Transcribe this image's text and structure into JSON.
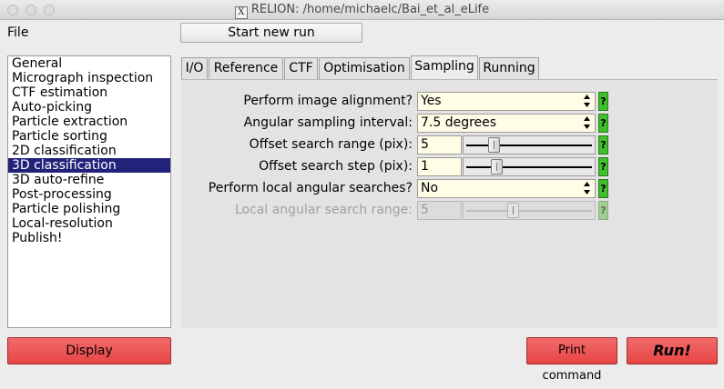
{
  "window": {
    "title": "RELION: /home/michaelc/Bai_et_al_eLife",
    "x_glyph": "X"
  },
  "menu": {
    "file_label": "File"
  },
  "toolbar": {
    "start_new_run_label": "Start new run"
  },
  "jobs": {
    "items": [
      "General",
      "Micrograph inspection",
      "CTF estimation",
      "Auto-picking",
      "Particle extraction",
      "Particle sorting",
      "2D classification",
      "3D classification",
      "3D auto-refine",
      "Post-processing",
      "Particle polishing",
      "Local-resolution",
      "Publish!"
    ],
    "selected": "3D classification"
  },
  "tabs": [
    "I/O",
    "Reference",
    "CTF",
    "Optimisation",
    "Sampling",
    "Running"
  ],
  "active_tab": "Sampling",
  "form": {
    "image_alignment": {
      "label": "Perform image alignment?",
      "value": "Yes",
      "help": "?"
    },
    "angular_interval": {
      "label": "Angular sampling interval:",
      "value": "7.5 degrees",
      "help": "?"
    },
    "offset_range": {
      "label": "Offset search range (pix):",
      "value": "5",
      "slider_fraction": 0.2,
      "help": "?"
    },
    "offset_step": {
      "label": "Offset search step (pix):",
      "value": "1",
      "slider_fraction": 0.22,
      "help": "?"
    },
    "local_searches": {
      "label": "Perform local angular searches?",
      "value": "No",
      "help": "?"
    },
    "local_range": {
      "label": "Local angular search range:",
      "value": "5",
      "slider_fraction": 0.36,
      "help": "?",
      "disabled": true
    }
  },
  "buttons": {
    "display_label": "Display",
    "print_command_label": "Print command",
    "run_label": "Run!"
  },
  "colors": {
    "selection": "#22227a",
    "help_green": "#3fbf2a",
    "button_red": "#e84545",
    "input_bg": "#fffde6"
  }
}
